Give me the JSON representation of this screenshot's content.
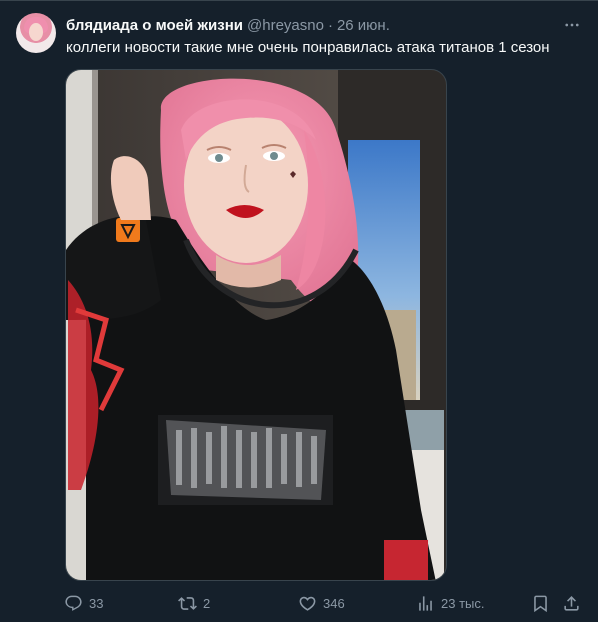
{
  "tweet": {
    "display_name": "блядиада о моей жизни",
    "handle": "@hreyasno",
    "separator": "·",
    "date": "26 июн.",
    "text": "коллеги новости такие мне очень понравилась атака титанов 1 сезон"
  },
  "actions": {
    "replies": "33",
    "retweets": "2",
    "likes": "346",
    "views": "23 тыс."
  },
  "colors": {
    "background": "#15202b",
    "text_primary": "#f7f9f9",
    "text_secondary": "#8b98a5",
    "border": "#38444d"
  },
  "icons": [
    "more-icon",
    "reply-icon",
    "retweet-icon",
    "like-icon",
    "views-icon",
    "bookmark-icon",
    "share-icon"
  ]
}
